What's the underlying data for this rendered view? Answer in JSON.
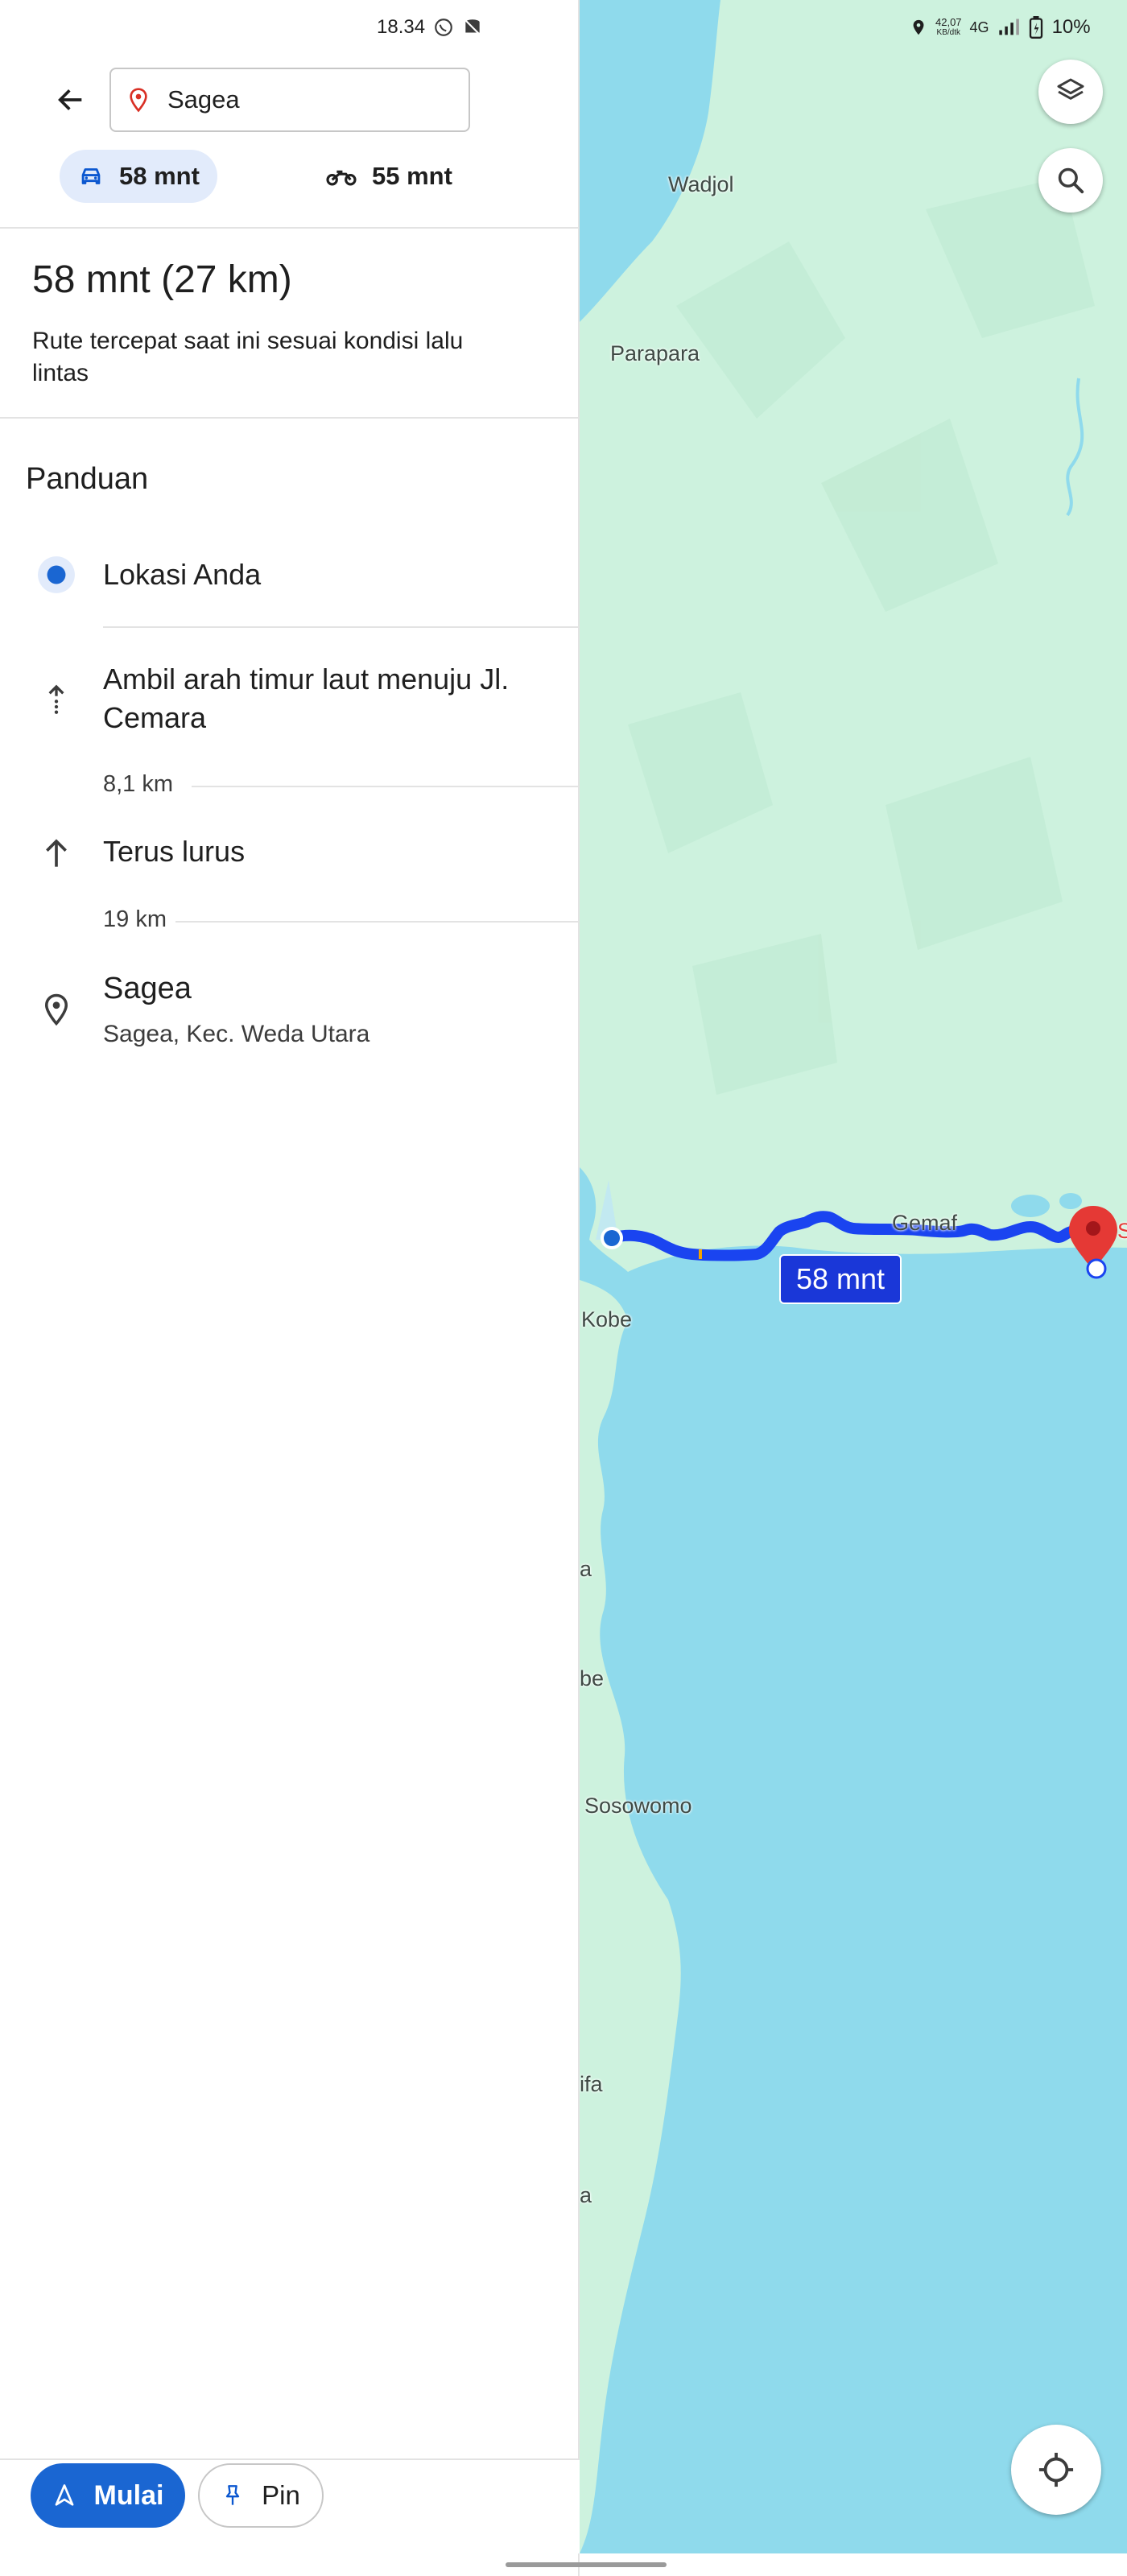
{
  "status_bar": {
    "time": "18.34",
    "net_speed_top": "42,07",
    "net_speed_unit": "KB/dtk",
    "network": "4G",
    "battery": "10%"
  },
  "search": {
    "destination": "Sagea"
  },
  "modes": [
    {
      "icon": "car-icon",
      "label": "58 mnt",
      "active": true
    },
    {
      "icon": "motorcycle-icon",
      "label": "55 mnt",
      "active": false
    }
  ],
  "summary": {
    "title": "58 mnt (27 km)",
    "subtitle": "Rute tercepat saat ini sesuai kondisi lalu lintas"
  },
  "guide": {
    "title": "Panduan",
    "origin": "Lokasi Anda",
    "steps": [
      {
        "icon": "arrow-up-dotted-icon",
        "text": "Ambil arah timur laut menuju Jl. Cemara",
        "distance": "8,1 km"
      },
      {
        "icon": "arrow-up-icon",
        "text": "Terus lurus",
        "distance": "19 km"
      }
    ],
    "destination": {
      "name": "Sagea",
      "address": "Sagea, Kec. Weda Utara"
    }
  },
  "map": {
    "labels": [
      "Wadjol",
      "Parapara",
      "Gemaf",
      "Kobe",
      "a",
      "be",
      "Sosowomo",
      "ifa",
      "a",
      "S"
    ],
    "route_badge": "58 mnt",
    "colors": {
      "land": "#cdf2de",
      "water": "#8fdaec",
      "route": "#1a44f0",
      "marker": "#e53935"
    }
  },
  "actions": {
    "start": "Mulai",
    "pin": "Pin"
  }
}
